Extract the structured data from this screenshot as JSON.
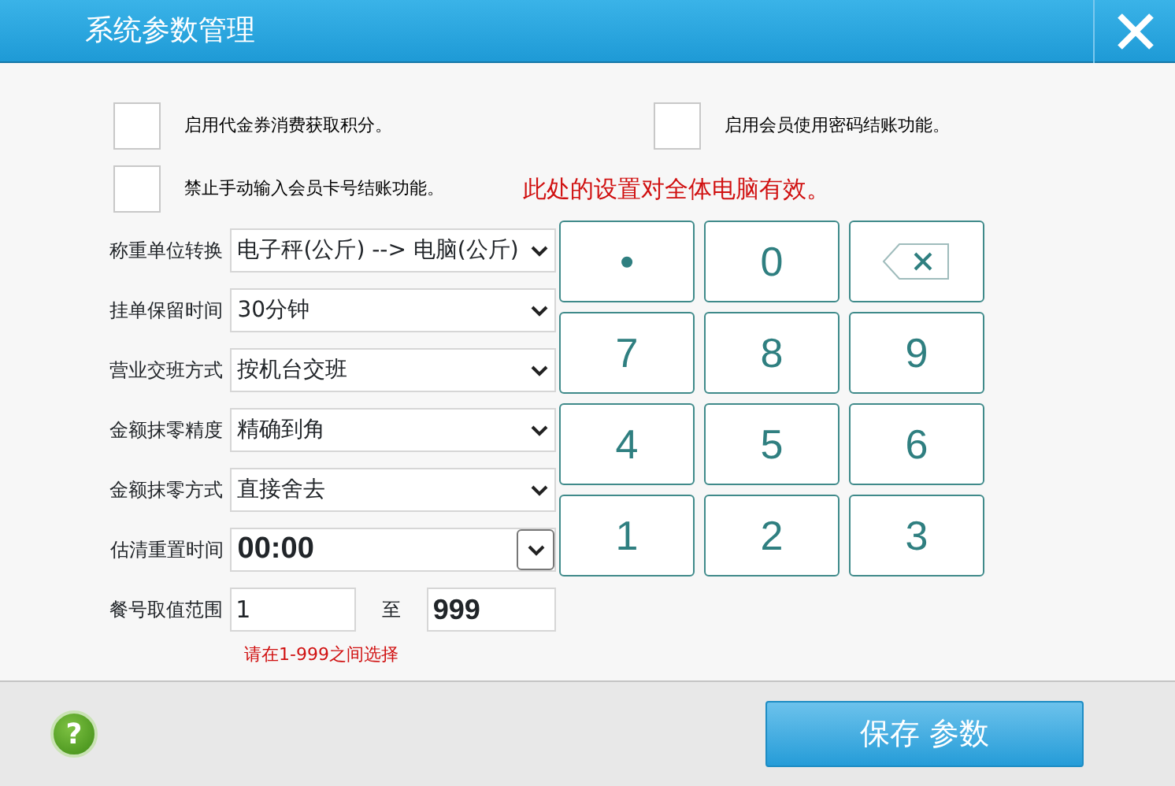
{
  "window": {
    "title": "系统参数管理"
  },
  "checkboxes": [
    {
      "label": "启用代金券消费获取积分。",
      "checked": false
    },
    {
      "label": "启用会员使用密码结账功能。",
      "checked": false
    },
    {
      "label": "禁止手动输入会员卡号结账功能。",
      "checked": false
    }
  ],
  "notice": "此处的设置对全体电脑有效。",
  "settings": [
    {
      "kind": "select",
      "label": "称重单位转换",
      "value": "电子秤(公斤) --> 电脑(公斤)"
    },
    {
      "kind": "select",
      "label": "挂单保留时间",
      "value": "30分钟"
    },
    {
      "kind": "select",
      "label": "营业交班方式",
      "value": "按机台交班"
    },
    {
      "kind": "select",
      "label": "金额抹零精度",
      "value": "精确到角"
    },
    {
      "kind": "select",
      "label": "金额抹零方式",
      "value": "直接舍去"
    },
    {
      "kind": "time",
      "label": "估清重置时间",
      "value": "00:00"
    },
    {
      "kind": "range",
      "label": "餐号取值范围",
      "from": "1",
      "separator": "至",
      "to": "999"
    }
  ],
  "range_hint": "请在1-999之间选择",
  "keypad": [
    {
      "kind": "text",
      "label": "•"
    },
    {
      "kind": "text",
      "label": "0"
    },
    {
      "kind": "backspace"
    },
    {
      "kind": "text",
      "label": "7"
    },
    {
      "kind": "text",
      "label": "8"
    },
    {
      "kind": "text",
      "label": "9"
    },
    {
      "kind": "text",
      "label": "4"
    },
    {
      "kind": "text",
      "label": "5"
    },
    {
      "kind": "text",
      "label": "6"
    },
    {
      "kind": "text",
      "label": "1"
    },
    {
      "kind": "text",
      "label": "2"
    },
    {
      "kind": "text",
      "label": "3"
    }
  ],
  "help_button": "?",
  "save_button": "保存 参数"
}
